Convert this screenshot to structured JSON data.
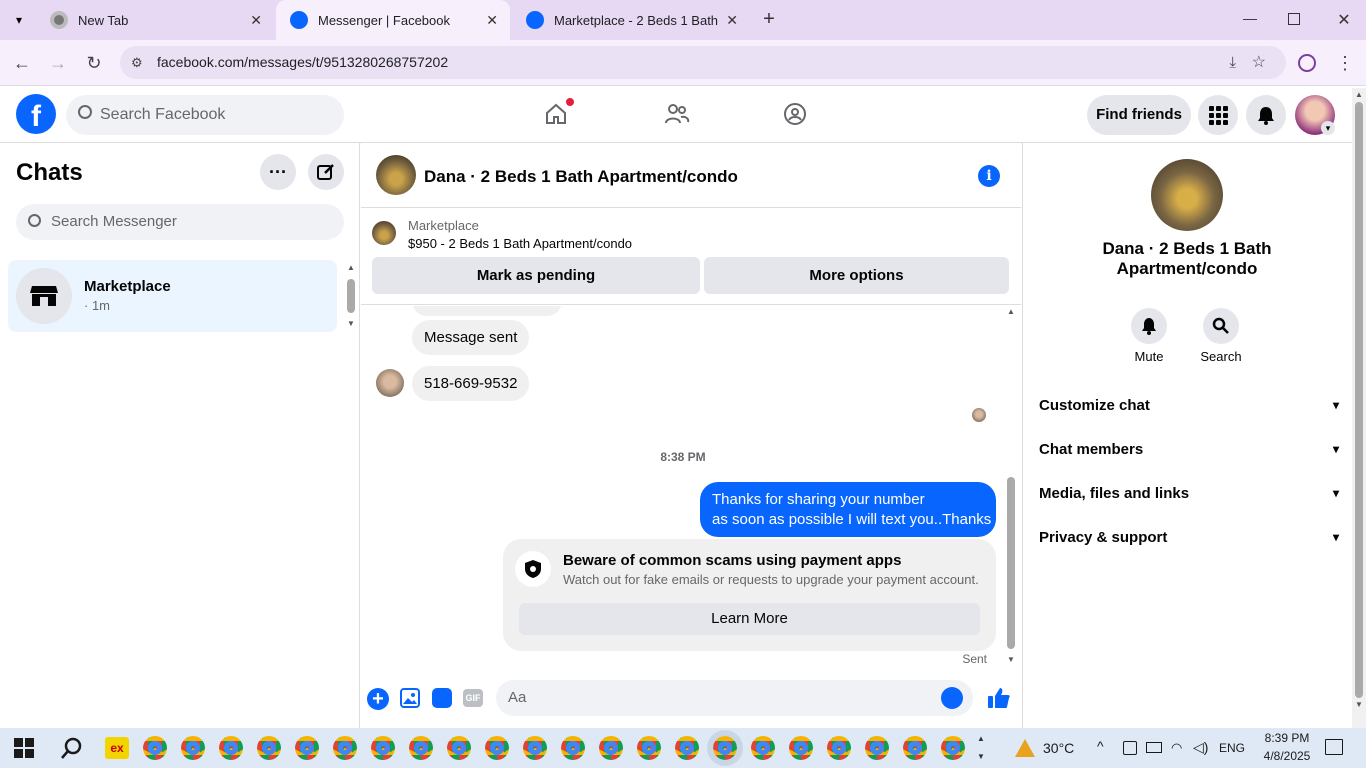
{
  "browser": {
    "tabs": [
      {
        "title": "New Tab"
      },
      {
        "title": "Messenger | Facebook"
      },
      {
        "title": "Marketplace - 2 Beds 1 Bath Ap"
      }
    ],
    "url": "facebook.com/messages/t/9513280268757202"
  },
  "header": {
    "search_placeholder": "Search Facebook",
    "find_friends": "Find friends"
  },
  "chats": {
    "title": "Chats",
    "search_placeholder": "Search Messenger",
    "items": [
      {
        "name": "Marketplace",
        "meta": "· 1m"
      }
    ]
  },
  "conversation": {
    "title": "Dana · 2 Beds 1 Bath Apartment/condo",
    "listing_source": "Marketplace",
    "listing": "$950 - 2 Beds 1 Bath Apartment/condo",
    "mark_pending": "Mark as pending",
    "more_options": "More options",
    "messages": [
      {
        "text": "Message sent"
      },
      {
        "text": "518-669-9532"
      }
    ],
    "timestamp": "8:38 PM",
    "sent_message_line1": "Thanks for sharing your number",
    "sent_message_line2": "as soon as possible I will text you..Thanks",
    "scam_title": "Beware of common scams using payment apps",
    "scam_body": "Watch out for fake emails or requests to upgrade your payment account.",
    "learn_more": "Learn More",
    "status": "Sent",
    "composer_placeholder": "Aa"
  },
  "details": {
    "name": "Dana · 2 Beds 1 Bath Apartment/condo",
    "mute": "Mute",
    "search": "Search",
    "sections": [
      {
        "label": "Customize chat"
      },
      {
        "label": "Chat members"
      },
      {
        "label": "Media, files and links"
      },
      {
        "label": "Privacy & support"
      }
    ]
  },
  "taskbar": {
    "temperature": "30°C",
    "language": "ENG",
    "time": "8:39 PM",
    "date": "4/8/2025"
  },
  "colors": {
    "accent": "#0866ff",
    "tab_bar": "#e7d8f3",
    "taskbar": "#dfe9f5"
  }
}
